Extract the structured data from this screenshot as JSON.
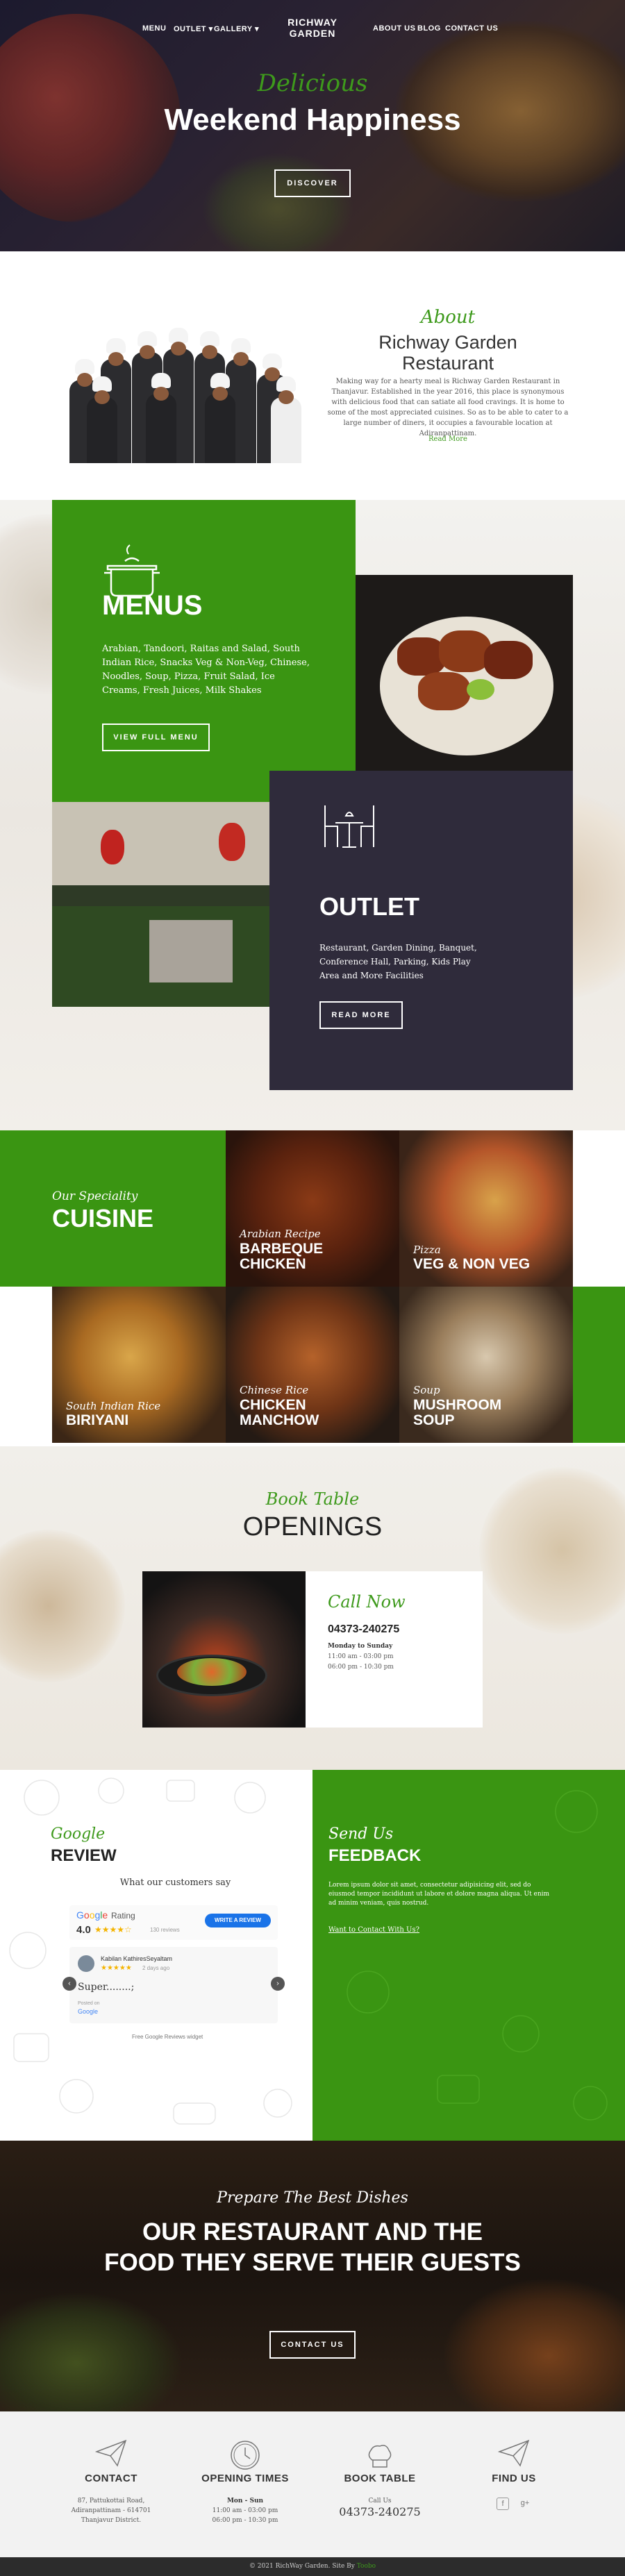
{
  "nav": {
    "menu": "MENU",
    "outlet": "OUTLET",
    "gallery": "GALLERY",
    "logo": [
      "RICHWAY",
      "GARDEN"
    ],
    "about": "ABOUT US",
    "blog": "BLOG",
    "contact": "CONTACT US"
  },
  "hero": {
    "script": "Delicious",
    "title": "Weekend Happiness",
    "button": "DISCOVER"
  },
  "about": {
    "script": "About",
    "title": "Richway Garden Restaurant",
    "text": "Making way for a hearty meal is Richway Garden Restaurant in Thanjavur. Established in the year 2016, this place is synonymous with delicious food that can satiate all food cravings. It is home to some of the most appreciated cuisines. So as to be able to cater to a large number of diners, it occupies a favourable location at Adiranpattinam.",
    "more": "Read More"
  },
  "menus": {
    "title": "MENUS",
    "text": "Arabian, Tandoori, Raitas and Salad, South Indian Rice, Snacks Veg & Non-Veg, Chinese, Noodles, Soup, Pizza, Fruit Salad, Ice Creams, Fresh Juices, Milk Shakes",
    "button": "VIEW FULL MENU"
  },
  "outlet": {
    "title": "OUTLET",
    "text": "Restaurant, Garden Dining, Banquet, Conference Hall, Parking, Kids Play Area and More Facilities",
    "button": "READ MORE"
  },
  "cuisine": {
    "script": "Our Speciality",
    "title": "CUISINE",
    "items": [
      {
        "sub": "Arabian Recipe",
        "name1": "BARBEQUE",
        "name2": "CHICKEN"
      },
      {
        "sub": "Pizza",
        "name1": "VEG & NON VEG",
        "name2": ""
      },
      {
        "sub": "South Indian Rice",
        "name1": "BIRIYANI",
        "name2": ""
      },
      {
        "sub": "Chinese Rice",
        "name1": "CHICKEN",
        "name2": "MANCHOW"
      },
      {
        "sub": "Soup",
        "name1": "MUSHROOM",
        "name2": "SOUP"
      }
    ]
  },
  "openings": {
    "script": "Book Table",
    "title": "OPENINGS",
    "call_script": "Call Now",
    "phone": "04373-240275",
    "days": "Monday to Sunday",
    "time1": "11:00 am - 03:00 pm",
    "time2": "06:00 pm - 10:30 pm"
  },
  "review": {
    "script": "Google",
    "title": "REVIEW",
    "heading": "What our customers say",
    "rating_label": "Rating",
    "rating_value": "4.0",
    "review_count": "130 reviews",
    "write_button": "WRITE A REVIEW",
    "reviewer": "Kabilan KathiresSeyaltam",
    "review_age": "2 days ago",
    "review_text": "Super........;",
    "posted_on": "Posted on",
    "posted_brand": "Google",
    "widget_note": "Free Google Reviews widget"
  },
  "feedback": {
    "script": "Send Us",
    "title": "FEEDBACK",
    "text": "Lorem ipsum dolor sit amet, consectetur adipisicing elit, sed do eiusmod tempor incididunt ut labore et dolore magna aliqua. Ut enim ad minim veniam, quis nostrud.",
    "link": "Want to Contact With Us?"
  },
  "dishes": {
    "script": "Prepare The Best Dishes",
    "title": "OUR RESTAURANT AND THE FOOD THEY SERVE THEIR GUESTS",
    "button": "CONTACT US"
  },
  "footer": {
    "contact": {
      "title": "CONTACT",
      "line1": "87, Pattukottai Road,",
      "line2": "Adiranpattinam - 614701",
      "line3": "Thanjavur District."
    },
    "hours": {
      "title": "OPENING TIMES",
      "days": "Mon - Sun",
      "time1": "11:00 am - 03:00 pm",
      "time2": "06:00 pm - 10:30 pm"
    },
    "book": {
      "title": "BOOK TABLE",
      "label": "Call Us",
      "phone": "04373-240275"
    },
    "follow": {
      "title": "FIND US",
      "fb": "f",
      "gplus": "g+"
    }
  },
  "copyright": "© 2021 RichWay Garden. Site By",
  "copyright_brand": "Toobo",
  "colors": {
    "green": "#3a9512",
    "dark": "#2f2b3b",
    "accent": "#3e9a1c"
  },
  "icons": [
    "chevron-down-icon",
    "pot-icon",
    "outlet-table-icon",
    "star-icon",
    "arrow-left-icon",
    "arrow-right-icon",
    "paper-plane-icon",
    "clock-icon",
    "chef-hat-icon",
    "facebook-icon",
    "google-plus-icon"
  ]
}
